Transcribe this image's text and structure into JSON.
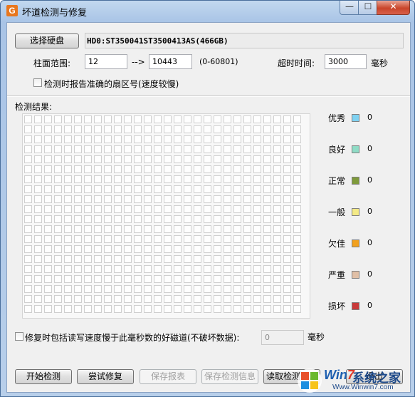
{
  "window": {
    "title": "坏道检测与修复"
  },
  "titlebar_buttons": {
    "min": "—",
    "max": "☐",
    "close": "✕"
  },
  "disk": {
    "select_button": "选择硬盘",
    "info": "HD0:ST350041ST3500413AS(466GB)"
  },
  "range": {
    "label": "柱面范围:",
    "start": "12",
    "arrow": "-->",
    "end": "10443",
    "hint": "(0-60801)"
  },
  "timeout": {
    "label": "超时时间:",
    "value": "3000",
    "unit": "毫秒"
  },
  "options": {
    "accurate_sector": "检测时报告准确的扇区号(速度较慢)"
  },
  "results": {
    "title": "检测结果:"
  },
  "legend": [
    {
      "label": "优秀",
      "color": "#7fd2f2",
      "count": "0"
    },
    {
      "label": "良好",
      "color": "#8fdcc6",
      "count": "0"
    },
    {
      "label": "正常",
      "color": "#7e9a3a",
      "count": "0"
    },
    {
      "label": "一般",
      "color": "#f4ea86",
      "count": "0"
    },
    {
      "label": "欠佳",
      "color": "#f2a11e",
      "count": "0"
    },
    {
      "label": "严重",
      "color": "#e0bfa6",
      "count": "0"
    },
    {
      "label": "损坏",
      "color": "#c93a3a",
      "count": "0"
    }
  ],
  "repair_option": {
    "label": "修复时包括读写速度慢于此毫秒数的好磁道(不破坏数据):",
    "value": "0",
    "unit": "毫秒"
  },
  "buttons": {
    "start": "开始检测",
    "try_repair": "尝试修复",
    "save_report": "保存报表",
    "save_info": "保存检测信息",
    "read_info": "读取检测信息",
    "exit": "退出"
  },
  "watermark": {
    "brand_w": "Win",
    "brand_7": "7",
    "brand_cn": "系统之家",
    "url": "Www.Winwin7.com"
  }
}
